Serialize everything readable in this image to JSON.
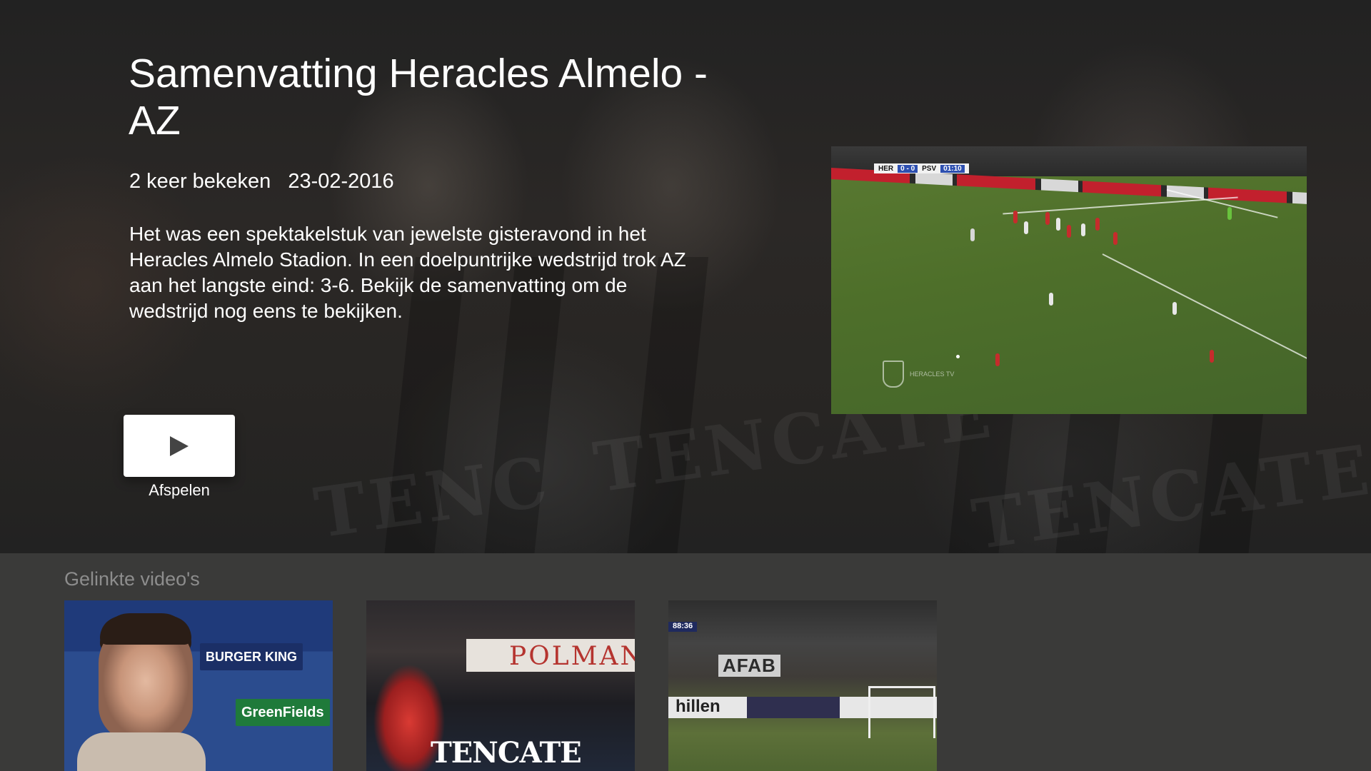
{
  "detail": {
    "title": "Samenvatting Heracles Almelo - AZ",
    "views": "2 keer bekeken",
    "date": "23-02-2016",
    "description": "Het was een spektakelstuk van jewelste gisteravond in het Heracles Almelo Stadion. In een doelpuntrijke wedstrijd trok AZ aan het langste eind: 3-6. Bekijk de samenvatting om de wedstrijd nog eens te bekijken.",
    "play_label": "Afspelen",
    "play_icon": "play-icon"
  },
  "preview": {
    "scorebug_home": "HER",
    "scorebug_score": "0 - 0",
    "scorebug_away": "PSV",
    "scorebug_time": "01:10",
    "watermark": "HERACLES TV"
  },
  "linked": {
    "heading": "Gelinkte video's",
    "cards": [
      {
        "sponsor_a": "BURGER KING",
        "sponsor_b": "GreenFields"
      },
      {
        "banner": "POLMAN",
        "ad": "TENCATE"
      },
      {
        "score": "88:36",
        "board": "AFAB",
        "sponsor": "hillen"
      }
    ]
  },
  "colors": {
    "background": "#1c1c1c",
    "shelf": "#3a3a39",
    "shelf_heading": "#8d8d8d",
    "button": "#ffffff"
  }
}
